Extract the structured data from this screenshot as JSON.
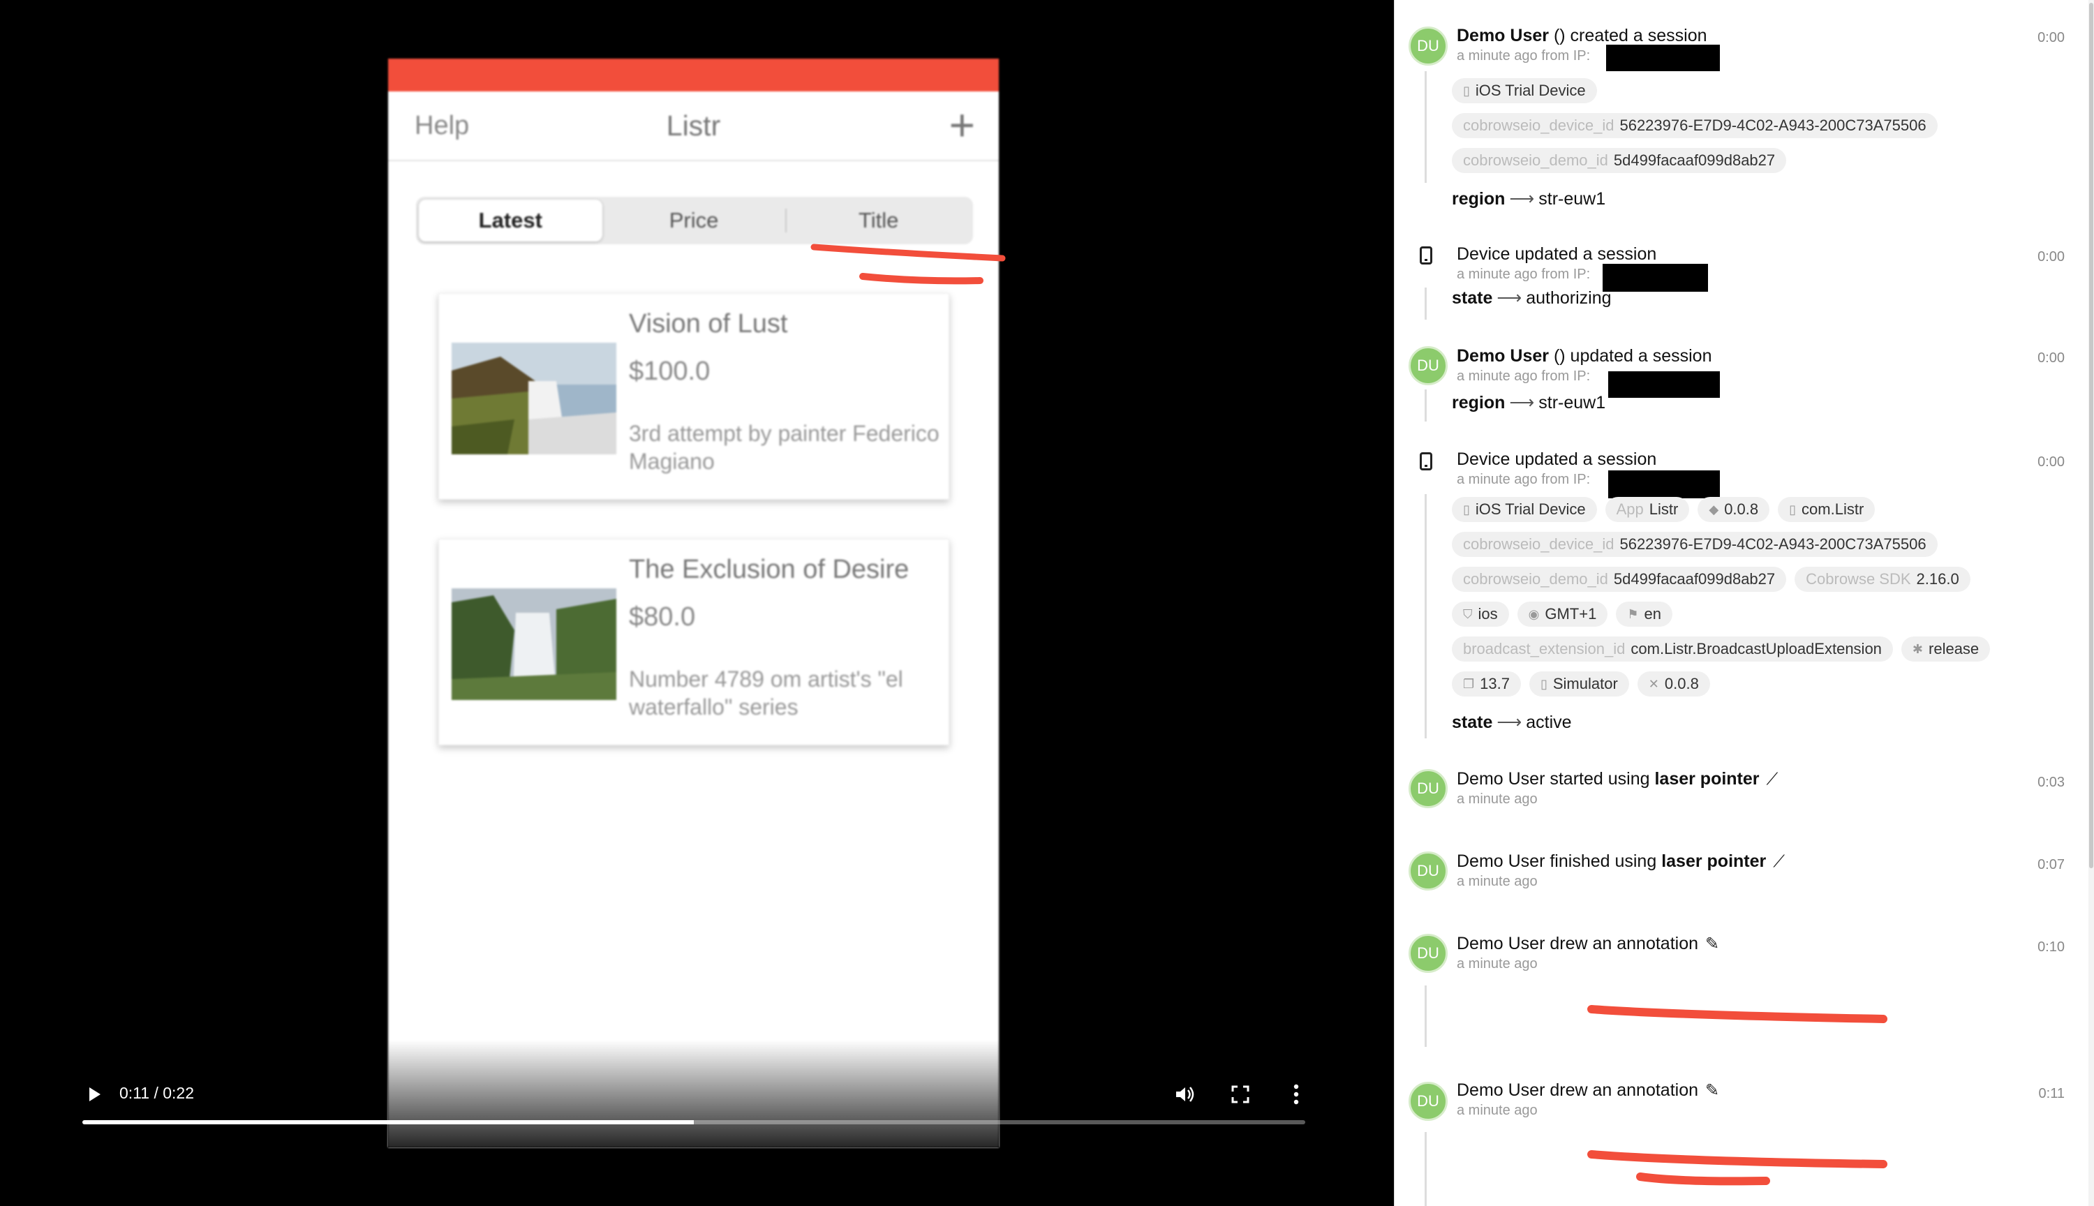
{
  "video": {
    "app": {
      "nav_left": "Help",
      "nav_title": "Listr",
      "nav_right_icon": "plus-icon",
      "status_bar_color": "#f24e3b",
      "tabs": [
        {
          "label": "Latest",
          "active": true
        },
        {
          "label": "Price",
          "active": false
        },
        {
          "label": "Title",
          "active": false
        }
      ],
      "listings": [
        {
          "title": "Vision of Lust",
          "price": "$100.0",
          "description": "3rd attempt by painter Federico Magiano"
        },
        {
          "title": "The Exclusion of Desire",
          "price": "$80.0",
          "description": "Number 4789 om artist's \"el waterfallo\" series"
        }
      ]
    },
    "controls": {
      "time": "0:11 / 0:22",
      "progress_fraction": 0.5,
      "play_icon": "play-icon",
      "volume_icon": "volume-icon",
      "fullscreen_icon": "fullscreen-icon",
      "more_icon": "more-vertical-icon"
    },
    "annotation_color": "#f24e3b"
  },
  "panel": {
    "avatar_initials": "DU",
    "avatar_color": "#8ccb6c",
    "arrow": "⟶",
    "events": {
      "e1": {
        "user": "Demo User",
        "action": "() created a session",
        "sub": "a minute ago from IP:",
        "time": "0:00",
        "device_chip": "iOS Trial Device",
        "device_id_key": "cobrowseio_device_id",
        "device_id": "56223976-E7D9-4C02-A943-200C73A75506",
        "demo_id_key": "cobrowseio_demo_id",
        "demo_id": "5d499facaaf099d8ab27",
        "kv_key": "region",
        "kv_val": "str-euw1"
      },
      "e2": {
        "title": "Device updated a session",
        "sub": "a minute ago from IP:",
        "time": "0:00",
        "kv_key": "state",
        "kv_val": "authorizing"
      },
      "e3": {
        "user": "Demo User",
        "action": "() updated a session",
        "sub": "a minute ago from IP:",
        "time": "0:00",
        "kv_key": "region",
        "kv_val": "str-euw1"
      },
      "e4": {
        "title": "Device updated a session",
        "sub": "a minute ago from IP:",
        "time": "0:00",
        "chips": {
          "device": "iOS Trial Device",
          "app_key": "App",
          "app": "Listr",
          "version": "0.0.8",
          "bundle": "com.Listr",
          "device_id_key": "cobrowseio_device_id",
          "device_id": "56223976-E7D9-4C02-A943-200C73A75506",
          "demo_id_key": "cobrowseio_demo_id",
          "demo_id": "5d499facaaf099d8ab27",
          "sdk_key": "Cobrowse SDK",
          "sdk": "2.16.0",
          "os": "ios",
          "tz": "GMT+1",
          "lang": "en",
          "ext_key": "broadcast_extension_id",
          "ext": "com.Listr.BroadcastUploadExtension",
          "build": "release",
          "os_version": "13.7",
          "sim": "Simulator",
          "tools": "0.0.8"
        },
        "kv_key": "state",
        "kv_val": "active"
      },
      "e5": {
        "prefix": "Demo User started using",
        "bold": "laser pointer",
        "sub": "a minute ago",
        "time": "0:03"
      },
      "e6": {
        "prefix": "Demo User finished using",
        "bold": "laser pointer",
        "sub": "a minute ago",
        "time": "0:07"
      },
      "e7": {
        "title": "Demo User drew an annotation",
        "sub": "a minute ago",
        "time": "0:10"
      },
      "e8": {
        "title": "Demo User drew an annotation",
        "sub": "a minute ago",
        "time": "0:11"
      }
    }
  }
}
